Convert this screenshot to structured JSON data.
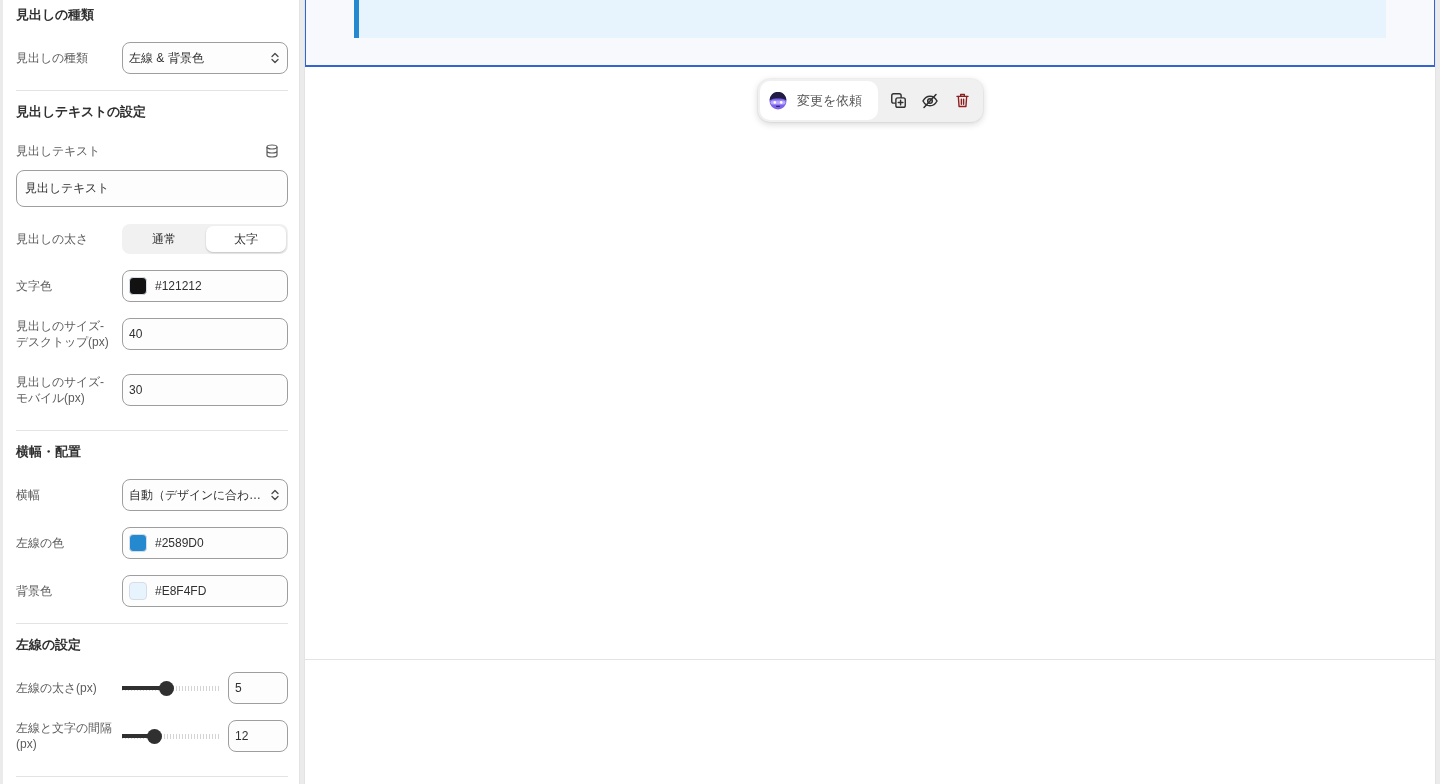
{
  "sidebar": {
    "sections": [
      {
        "title": "見出しの種類",
        "fields": [
          {
            "kind": "select",
            "label": "見出しの種類",
            "value": "左線 & 背景色"
          }
        ]
      },
      {
        "title": "見出しテキストの設定",
        "fields": [
          {
            "kind": "text",
            "label": "見出しテキスト",
            "value": "見出しテキスト"
          },
          {
            "kind": "segmented",
            "label": "見出しの太さ",
            "options": [
              {
                "label": "通常",
                "selected": false
              },
              {
                "label": "太字",
                "selected": true
              }
            ]
          },
          {
            "kind": "color",
            "label": "文字色",
            "value": "#121212",
            "color": "#121212"
          },
          {
            "kind": "number",
            "label": "見出しのサイズ-デスクトップ(px)",
            "value": "40"
          },
          {
            "kind": "number",
            "label": "見出しのサイズ-モバイル(px)",
            "value": "30"
          }
        ]
      },
      {
        "title": "横幅・配置",
        "fields": [
          {
            "kind": "select",
            "label": "横幅",
            "value": "自動（デザインに合わ…"
          },
          {
            "kind": "color",
            "label": "左線の色",
            "value": "#2589D0",
            "color": "#2589d0"
          },
          {
            "kind": "color",
            "label": "背景色",
            "value": "#E8F4FD",
            "color": "#e8f4fd"
          }
        ]
      },
      {
        "title": "左線の設定",
        "fields": [
          {
            "kind": "slider",
            "label": "左線の太さ(px)",
            "level": 0.44,
            "value": "5"
          },
          {
            "kind": "slider",
            "label": "左線と文字の間隔(px)",
            "level": 0.3,
            "value": "12"
          }
        ]
      }
    ]
  },
  "toolbar": {
    "request_button": "変更を依頼"
  }
}
